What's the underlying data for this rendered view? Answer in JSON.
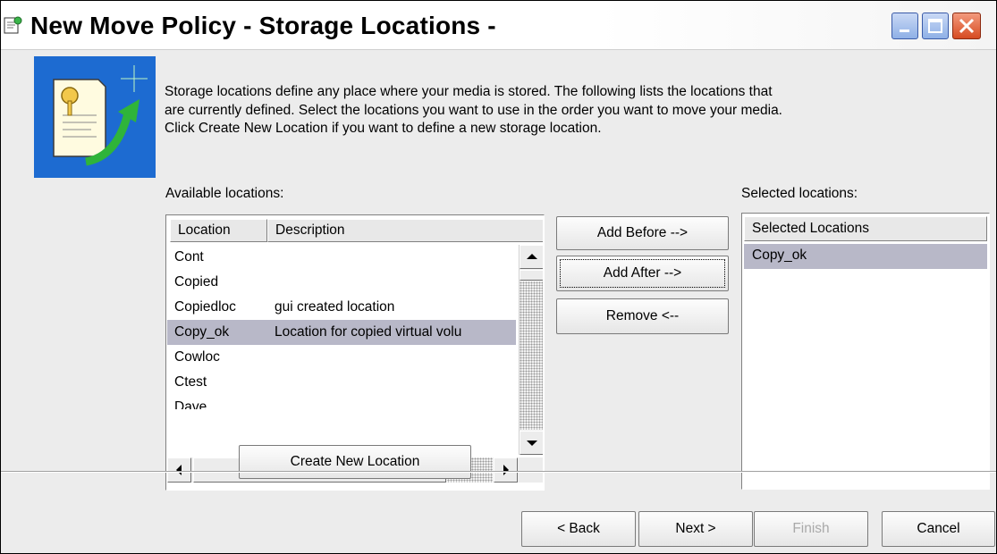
{
  "window": {
    "title": "New Move Policy - Storage Locations -",
    "controls": {
      "minimize_icon": "minimize-icon",
      "maximize_icon": "maximize-icon",
      "close_icon": "close-icon"
    }
  },
  "intro_text": "Storage locations define any place where your media is stored.  The following lists the locations that\nare currently defined.  Select the locations you want to use in the order you want to move your media.\nClick Create New Location if you want to define a new storage location.",
  "available": {
    "label": "Available locations:",
    "columns": [
      "Location",
      "Description"
    ],
    "rows": [
      {
        "location": "Cont",
        "description": ""
      },
      {
        "location": "Copied",
        "description": ""
      },
      {
        "location": "Copiedloc",
        "description": "gui created location"
      },
      {
        "location": "Copy_ok",
        "description": "Location for copied virtual volu",
        "selected": true
      },
      {
        "location": "Cowloc",
        "description": ""
      },
      {
        "location": "Ctest",
        "description": ""
      },
      {
        "location": "Dave",
        "description": ""
      }
    ]
  },
  "buttons": {
    "add_before": "Add Before -->",
    "add_after": "Add After -->",
    "remove": "Remove <--",
    "create_new_location": "Create New Location"
  },
  "selected": {
    "label": "Selected locations:",
    "column": "Selected Locations",
    "rows": [
      "Copy_ok"
    ]
  },
  "footer": {
    "back": "< Back",
    "next": "Next >",
    "finish": "Finish",
    "cancel": "Cancel"
  },
  "colors": {
    "selection": "#b8b8c8",
    "dialog_bg": "#ececec",
    "hero_blue": "#1d6bd1",
    "close_red": "#d64b21"
  }
}
